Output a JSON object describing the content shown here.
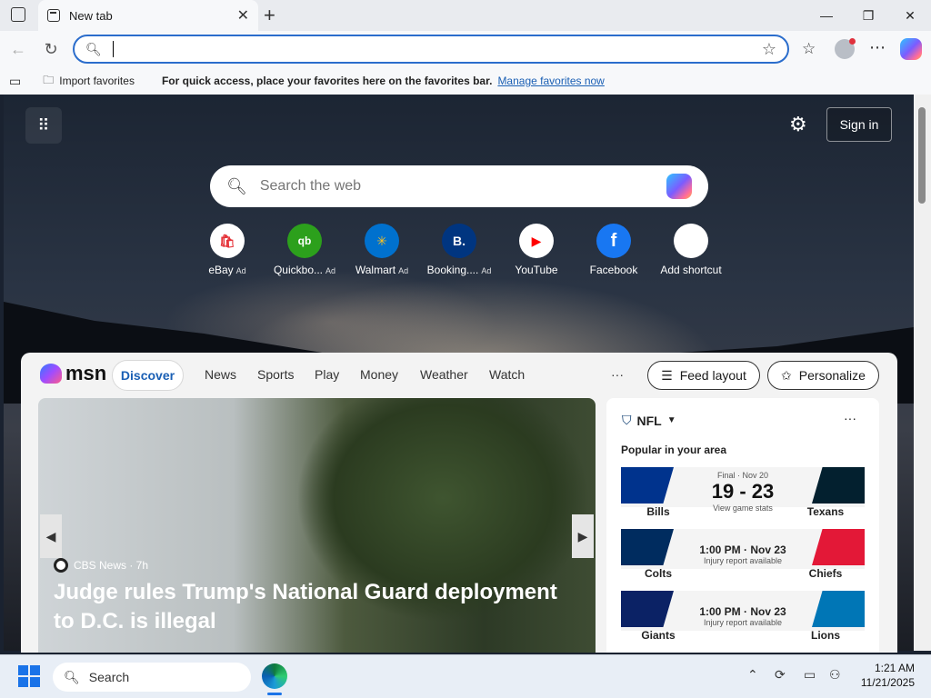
{
  "browser": {
    "tab_title": "New tab",
    "close_tab": "✕",
    "new_tab": "+",
    "address_placeholder": "",
    "window_buttons": {
      "minimize": "—",
      "restore": "❐",
      "close": "✕"
    }
  },
  "favbar": {
    "import_label": "Import favorites",
    "message": "For quick access, place your favorites here on the favorites bar.",
    "manage_link": "Manage favorites now"
  },
  "hero": {
    "sign_in": "Sign in",
    "search_placeholder": "Search the web",
    "tiles": [
      {
        "label": "eBay",
        "ad": "Ad",
        "glyph": "🛍"
      },
      {
        "label": "Quickbo...",
        "ad": "Ad",
        "glyph": "qb"
      },
      {
        "label": "Walmart",
        "ad": "Ad",
        "glyph": "✳"
      },
      {
        "label": "Booking....",
        "ad": "Ad",
        "glyph": "B."
      },
      {
        "label": "YouTube",
        "ad": "",
        "glyph": "▶"
      },
      {
        "label": "Facebook",
        "ad": "",
        "glyph": "f"
      },
      {
        "label": "Add shortcut",
        "ad": "",
        "glyph": "+"
      }
    ]
  },
  "msn": {
    "logo": "msn",
    "nav": [
      "Discover",
      "News",
      "Sports",
      "Play",
      "Money",
      "Weather",
      "Watch"
    ],
    "more": "···",
    "feed_layout": "Feed layout",
    "personalize": "Personalize",
    "news": {
      "source": "CBS News · 7h",
      "headline": "Judge rules Trump's National Guard deployment to D.C. is illegal"
    },
    "nfl": {
      "title": "NFL",
      "more": "···",
      "subtitle": "Popular in your area",
      "games": [
        {
          "left": "Bills",
          "right": "Texans",
          "status": "Final · Nov 20",
          "score": "19 - 23",
          "note": "View game stats",
          "left_color": "#00338d",
          "right_color": "#03202f"
        },
        {
          "left": "Colts",
          "right": "Chiefs",
          "status": "",
          "time": "1:00 PM · Nov 23",
          "note": "Injury report available",
          "left_color": "#002c5f",
          "right_color": "#e31837"
        },
        {
          "left": "Giants",
          "right": "Lions",
          "status": "",
          "time": "1:00 PM · Nov 23",
          "note": "Injury report available",
          "left_color": "#0b2265",
          "right_color": "#0076b6"
        }
      ]
    }
  },
  "taskbar": {
    "search": "Search",
    "time": "1:21 AM",
    "date": "11/21/2025"
  }
}
